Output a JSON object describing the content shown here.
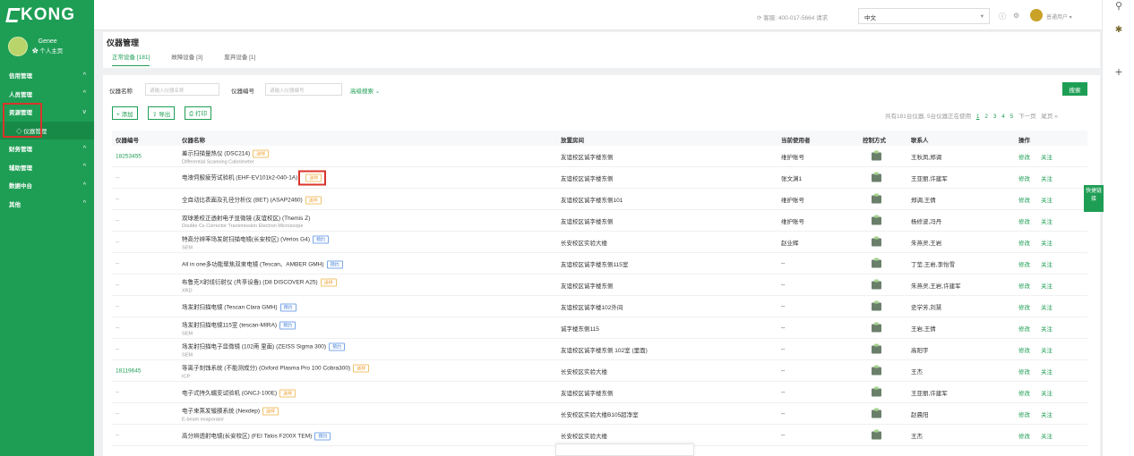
{
  "sidebar": {
    "logo": "KONG",
    "user_name": "Genee",
    "user_home": "✿ 个人主页",
    "items": [
      {
        "label": "信用管理",
        "chevron": "^"
      },
      {
        "label": "人员管理",
        "chevron": "^"
      },
      {
        "label": "资源管理",
        "chevron": "v"
      },
      {
        "label": "◇ 仪器管理",
        "chevron": ""
      },
      {
        "label": "财务管理",
        "chevron": "^"
      },
      {
        "label": "辅助管理",
        "chevron": "^"
      },
      {
        "label": "数据中台",
        "chevron": "^"
      },
      {
        "label": "其他",
        "chevron": "^"
      }
    ]
  },
  "topbar": {
    "phone": "客服: 400-017-5664 请求",
    "language": "中文",
    "user_role": "普通用户"
  },
  "header": {
    "title": "仪器管理",
    "tabs": [
      {
        "label": "正常设备 [181]"
      },
      {
        "label": "故障设备 [3]"
      },
      {
        "label": "废弃设备 [1]"
      }
    ]
  },
  "filters": {
    "name_label": "仪器名称",
    "name_placeholder": "请输入仪器名称",
    "code_label": "仪器编号",
    "code_placeholder": "请输入仪器编号",
    "advanced": "高级搜索",
    "search": "搜索"
  },
  "toolbar": {
    "add": "+ 添加",
    "export": "导出",
    "print": "打印"
  },
  "pagination": {
    "summary": "共有181台仪器, 5台仪器正在使用",
    "pages": [
      "1",
      "2",
      "3",
      "4",
      "5"
    ],
    "next": "下一页",
    "last": "尾页 »"
  },
  "table": {
    "headers": [
      "仪器编号",
      "仪器名称",
      "放置房间",
      "当前使用者",
      "控制方式",
      "联系人",
      "操作"
    ],
    "rows": [
      {
        "code": "18253455",
        "name": "差示扫描量热仪 (DSC214)",
        "subname": "Differential Scanning Calorimeter",
        "badge": "送样",
        "badge_type": "orange",
        "room": "友谊校区诚字楼东侧",
        "user": "维护账号",
        "contact": "王秋凤,郑调"
      },
      {
        "code": "--",
        "name": "电液伺服疲劳试验机 (EHF-EV101k2-040-1A)",
        "subname": "",
        "badge": "送样",
        "badge_type": "orange",
        "room": "友谊校区诚字楼东侧",
        "user": "张文渊1",
        "contact": "王亚丽,许建军"
      },
      {
        "code": "--",
        "name": "全自动比表面及孔径分析仪 (BET) (ASAP2460)",
        "subname": "",
        "badge": "送样",
        "badge_type": "orange",
        "room": "友谊校区诚字楼东侧101",
        "user": "维护账号",
        "contact": "郑调,王倩"
      },
      {
        "code": "--",
        "name": "双球差校正透射电子显微镜 (友谊校区) (Themis Z)",
        "subname": "Double Cs Corrector Transmission Electron Microscope",
        "badge": "",
        "badge_type": "",
        "room": "友谊校区诚字楼东侧",
        "user": "维护账号",
        "contact": "杨修波,冯丹"
      },
      {
        "code": "--",
        "name": "特高分辨率场发射扫描电镜(长安校区) (Verios G4)",
        "subname": "SEM",
        "badge": "预约",
        "badge_type": "blue",
        "room": "长安校区实验大楼",
        "user": "赵业辉",
        "contact": "朱燕灵,王岩"
      },
      {
        "code": "--",
        "name": "All in one多功能聚焦双束电镜 (Tescan、AMBER GMH)",
        "subname": "",
        "badge": "预约",
        "badge_type": "blue",
        "room": "友谊校区诚字楼东侧115室",
        "user": "--",
        "contact": "丁莹,王岩,李怡雪"
      },
      {
        "code": "--",
        "name": "布鲁克X射线衍射仪 (共享设备) (D8 DISCOVER A25)",
        "subname": "XRD",
        "badge": "送样",
        "badge_type": "orange",
        "room": "友谊校区诚字楼东侧",
        "user": "--",
        "contact": "朱燕灵,王岩,许建军"
      },
      {
        "code": "--",
        "name": "场发射扫描电镜 (Tescan Clara GMH)",
        "subname": "",
        "badge": "预约",
        "badge_type": "blue",
        "room": "友谊校区诚字楼102外间",
        "user": "--",
        "contact": "史学芳,刘慧"
      },
      {
        "code": "--",
        "name": "场发射扫描电镜115室 (tescan-MIRA)",
        "subname": "SEM",
        "badge": "预约",
        "badge_type": "blue",
        "room": "诚字楼东侧115",
        "user": "--",
        "contact": "王岩,王倩"
      },
      {
        "code": "--",
        "name": "场发射扫描电子显微镜 (102南 里面) (ZEISS Sigma 300)",
        "subname": "SEM",
        "badge": "预约",
        "badge_type": "blue",
        "room": "友谊校区诚字楼东侧 102室 (里面)",
        "user": "--",
        "contact": "高阳宇"
      },
      {
        "code": "18119645",
        "name": "等离子刻蚀系统 (不能测成分) (Oxford Plasma Pro 100 Cobra300)",
        "subname": "ICP",
        "badge": "送样",
        "badge_type": "orange",
        "room": "长安校区实验大楼",
        "user": "--",
        "contact": "王杰"
      },
      {
        "code": "--",
        "name": "电子式持久蠕变试验机 (GNCJ-100E)",
        "subname": "",
        "badge": "送样",
        "badge_type": "orange",
        "room": "友谊校区诚字楼东侧",
        "user": "--",
        "contact": "王亚丽,许建军"
      },
      {
        "code": "--",
        "name": "电子束蒸发镀膜系统 (Nexdep)",
        "subname": "E-beam evaporator",
        "badge": "送样",
        "badge_type": "orange",
        "room": "长安校区实验大楼B105超净室",
        "user": "--",
        "contact": "赵晨阳"
      },
      {
        "code": "--",
        "name": "高分辨透射电镜(长安校区) (FEI Talos F200X TEM)",
        "subname": "",
        "badge": "预约",
        "badge_type": "blue",
        "room": "长安校区实验大楼",
        "user": "--",
        "contact": "王杰"
      }
    ],
    "actions": [
      "修改",
      "关注"
    ]
  },
  "float_link": "快捷链接",
  "colors": {
    "brand": "#1e9e55",
    "highlight": "#d9342b"
  }
}
